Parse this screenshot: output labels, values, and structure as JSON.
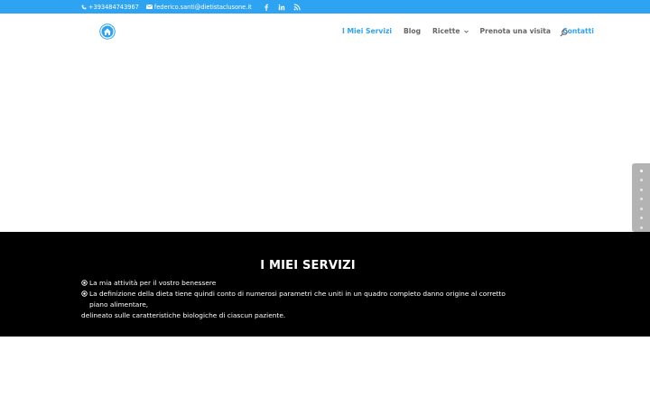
{
  "topbar": {
    "phone": "+393484743967",
    "email": "federico.santi@dietistaclusone.it",
    "social_icons": [
      "facebook-icon",
      "linkedin-icon",
      "rss-icon"
    ],
    "color": "#2ea3f2"
  },
  "header": {
    "logo_icon": "home-icon",
    "nav": [
      {
        "label": "I Miei Servizi",
        "active": true
      },
      {
        "label": "Blog",
        "active": false
      },
      {
        "label": "Ricette",
        "active": false,
        "dropdown": true
      },
      {
        "label": "Prenota una visita",
        "active": false
      },
      {
        "label": "Contatti",
        "active": true
      }
    ],
    "search_icon": "search-icon"
  },
  "side_nav": {
    "dots": 7,
    "active_index": 0
  },
  "services": {
    "title": "I MIEI SERVIZI",
    "line1": "La mia attività per il vostro benessere",
    "line2": "La definizione della dieta tiene quindi conto di numerosi parametri che uniti in un quadro completo danno origine al corretto piano alimentare,",
    "line3": "delineato sulle caratteristiche biologiche di ciascun paziente.",
    "background": "#000000"
  },
  "colors": {
    "accent": "#2ea3f2",
    "nav_text": "#666666"
  }
}
